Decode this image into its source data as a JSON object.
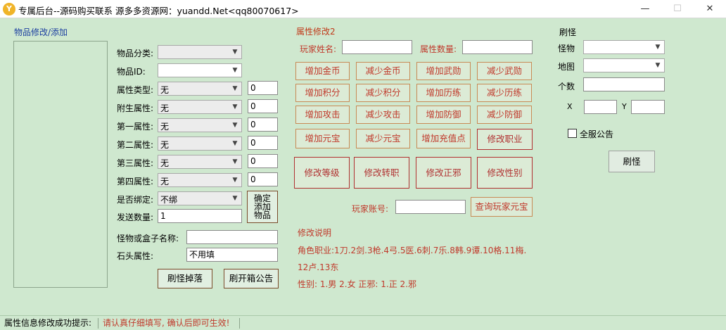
{
  "titlebar": {
    "icon_letter": "Y",
    "title": "专属后台--源码购买联系 源多多资源网：yuandd.Net<qq80070617>",
    "minimize": "—",
    "maximize": "☐",
    "close": "✕"
  },
  "item_panel": {
    "group_title": "物品修改/添加",
    "category_label": "物品分类:",
    "category_value": "",
    "item_id_label": "物品ID:",
    "item_id_value": "",
    "attr_type_label": "属性类型:",
    "attr_type_value": "无",
    "attr_type_num": "0",
    "attached_label": "附生属性:",
    "attached_value": "无",
    "attached_num": "0",
    "attr1_label": "第一属性:",
    "attr1_value": "无",
    "attr1_num": "0",
    "attr2_label": "第二属性:",
    "attr2_value": "无",
    "attr2_num": "0",
    "attr3_label": "第三属性:",
    "attr3_value": "无",
    "attr3_num": "0",
    "attr4_label": "第四属性:",
    "attr4_value": "无",
    "attr4_num": "0",
    "bind_label": "是否绑定:",
    "bind_value": "不绑",
    "send_qty_label": "发送数量:",
    "send_qty_value": "1",
    "confirm_add_button": [
      "确定",
      "添加",
      "物品"
    ],
    "monster_box_label": "怪物或盒子名称:",
    "monster_box_value": "",
    "stone_attr_label": "石头属性:",
    "stone_attr_value": "不用填",
    "spawn_drop_button": "刷怪掉落",
    "open_box_notice_button": "刷开箱公告"
  },
  "attr_panel": {
    "group_title": "属性修改2",
    "player_name_label": "玩家姓名:",
    "player_name_value": "",
    "attr_qty_label": "属性数量:",
    "attr_qty_value": "",
    "small_buttons": [
      [
        "增加金币",
        "减少金币",
        "增加武勋",
        "减少武勋"
      ],
      [
        "增加积分",
        "减少积分",
        "增加历练",
        "减少历练"
      ],
      [
        "增加攻击",
        "减少攻击",
        "增加防御",
        "减少防御"
      ],
      [
        "增加元宝",
        "减少元宝",
        "增加充值点",
        "修改职业"
      ]
    ],
    "big_buttons": [
      "修改等级",
      "修改转职",
      "修改正邪",
      "修改性别"
    ],
    "account_label": "玩家账号:",
    "account_value": "",
    "query_yuanbao_button": "查询玩家元宝",
    "notes_title": "修改说明",
    "notes_line1": "角色职业:1刀.2剑.3枪.4弓.5医.6刺.7乐.8韩.9谭.10格.11梅.",
    "notes_line2": "12卢.13东",
    "notes_line3": "性别: 1.男 2.女    正邪: 1.正 2.邪"
  },
  "spawn_panel": {
    "group_title": "刷怪",
    "monster_label": "怪物",
    "monster_value": "",
    "map_label": "地图",
    "map_value": "",
    "count_label": "个数",
    "count_value": "",
    "x_label": "X",
    "x_value": "",
    "y_label": "Y",
    "y_value": "",
    "server_notice_label": "全服公告",
    "server_notice_checked": false,
    "spawn_button": "刷怪"
  },
  "statusbar": {
    "info": "属性信息修改成功提示:",
    "warning": "请认真仔细填写, 确认后即可生效!"
  },
  "colors": {
    "background": "#cfe8cf",
    "accent_red": "#c0392b",
    "accent_blue": "#1c3fa0"
  }
}
